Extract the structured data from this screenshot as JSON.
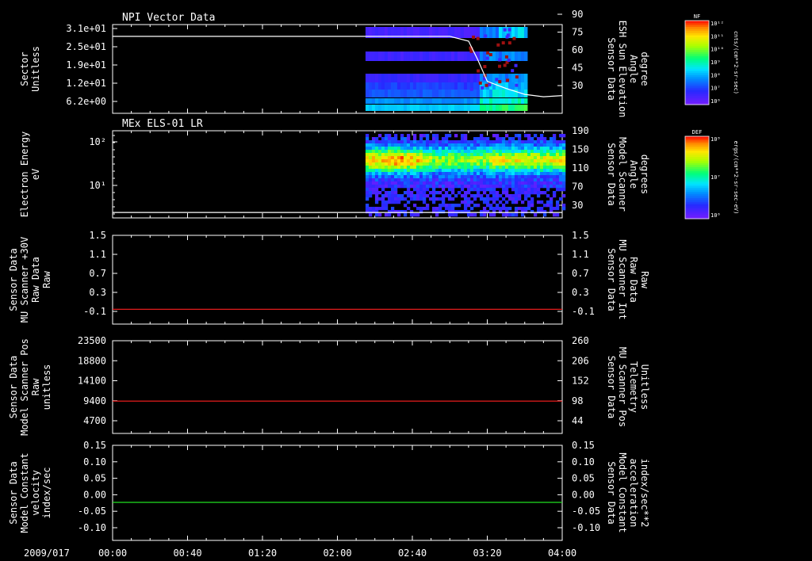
{
  "chart_data": [
    {
      "type": "heatmap",
      "title": "NPI Vector Data",
      "ylabel_lines": [
        "Sector",
        "Unitless"
      ],
      "y_ticks": [
        "3.1e+01",
        "2.5e+01",
        "1.9e+01",
        "1.2e+01",
        "6.2e+00"
      ],
      "right_label_lines": [
        "Sensor Data",
        "ESH Sun Elevation",
        "Angle",
        "degree"
      ],
      "right_ticks": [
        "90",
        "75",
        "60",
        "45",
        "30"
      ],
      "right_range": [
        15,
        90
      ],
      "overlay_line": {
        "color": "#ffffff",
        "x": [
          "00:00",
          "03:00",
          "03:10",
          "03:15",
          "03:20",
          "03:30",
          "03:40",
          "03:50",
          "04:00"
        ],
        "y": [
          80,
          80,
          76,
          60,
          42,
          36,
          31,
          29,
          30
        ]
      },
      "data_start": "02:15",
      "data_end": "03:40",
      "colorbar": {
        "label": "NF",
        "unit": "cnts/(cm**2-sr-sec)",
        "tick_labels": [
          "10¹²",
          "10¹¹",
          "10¹⁰",
          "10⁹",
          "10⁸",
          "10⁷",
          "10⁶"
        ]
      }
    },
    {
      "type": "heatmap",
      "title": "MEx ELS-01 LR",
      "ylabel_lines": [
        "Electron Energy",
        "eV"
      ],
      "y_ticks": [
        "10²",
        "10¹"
      ],
      "log_scale": true,
      "right_label_lines": [
        "Sensor Data",
        "Model Scanner",
        "Angle",
        "degrees"
      ],
      "right_ticks": [
        "190",
        "150",
        "110",
        "70",
        "30"
      ],
      "right_range": [
        0,
        190
      ],
      "overlay_line": {
        "color": "#ffffff",
        "x": [
          "00:00",
          "04:00"
        ],
        "y": [
          12,
          12
        ]
      },
      "data_start": "02:15",
      "data_end": "04:00",
      "colorbar": {
        "label": "DEF",
        "unit": "ergs/(cm**2-sr-sec-eV)",
        "tick_labels": [
          "10⁸",
          "10⁷",
          "10⁶"
        ]
      }
    },
    {
      "type": "line",
      "ylabel_lines": [
        "Sensor Data",
        "MU Scanner +30V",
        "Raw Data",
        "Raw"
      ],
      "y_ticks": [
        "1.5",
        "1.1",
        "0.7",
        "0.3",
        "-0.1"
      ],
      "ylim": [
        -0.3,
        1.5
      ],
      "right_label_lines": [
        "Sensor Data",
        "MU Scanner Int",
        "Raw Data",
        "Raw"
      ],
      "right_label_color": "#ff2020",
      "right_ticks": [
        "1.5",
        "1.1",
        "0.7",
        "0.3",
        "-0.1"
      ],
      "series": [
        {
          "color": "#ff2020",
          "x": [
            "00:00",
            "04:00"
          ],
          "y": [
            0.0,
            0.0
          ]
        }
      ]
    },
    {
      "type": "line",
      "ylabel_lines": [
        "Sensor Data",
        "Model Scanner Pos",
        "Raw",
        "unitless"
      ],
      "y_ticks": [
        "23500",
        "18800",
        "14100",
        "9400",
        "4700"
      ],
      "ylim": [
        0,
        23500
      ],
      "right_label_lines": [
        "Sensor Data",
        "MU Scanner Pos",
        "Telemetry",
        "Unitless"
      ],
      "right_label_color": "#ff2020",
      "right_ticks": [
        "260",
        "206",
        "152",
        "98",
        "44"
      ],
      "series": [
        {
          "color": "#ff2020",
          "x": [
            "00:00",
            "04:00"
          ],
          "y": [
            8200,
            8200
          ]
        }
      ]
    },
    {
      "type": "line",
      "ylabel_lines": [
        "Sensor Data",
        "Model Constant",
        "velocity",
        "index/sec"
      ],
      "y_ticks": [
        "0.15",
        "0.10",
        "0.05",
        "0.00",
        "-0.05",
        "-0.10"
      ],
      "ylim": [
        -0.1,
        0.15
      ],
      "right_label_lines": [
        "Sensor Data",
        "Model Constant",
        "acceleration",
        "index/sec**2"
      ],
      "right_label_color": "#20e020",
      "right_ticks": [
        "0.15",
        "0.10",
        "0.05",
        "0.00",
        "-0.05",
        "-0.10"
      ],
      "series": [
        {
          "color": "#20e020",
          "x": [
            "00:00",
            "04:00"
          ],
          "y": [
            0.0,
            0.0
          ]
        }
      ]
    }
  ],
  "time_axis": {
    "date": "2009/017",
    "ticks": [
      "00:00",
      "00:40",
      "01:20",
      "02:00",
      "02:40",
      "03:20",
      "04:00"
    ]
  }
}
